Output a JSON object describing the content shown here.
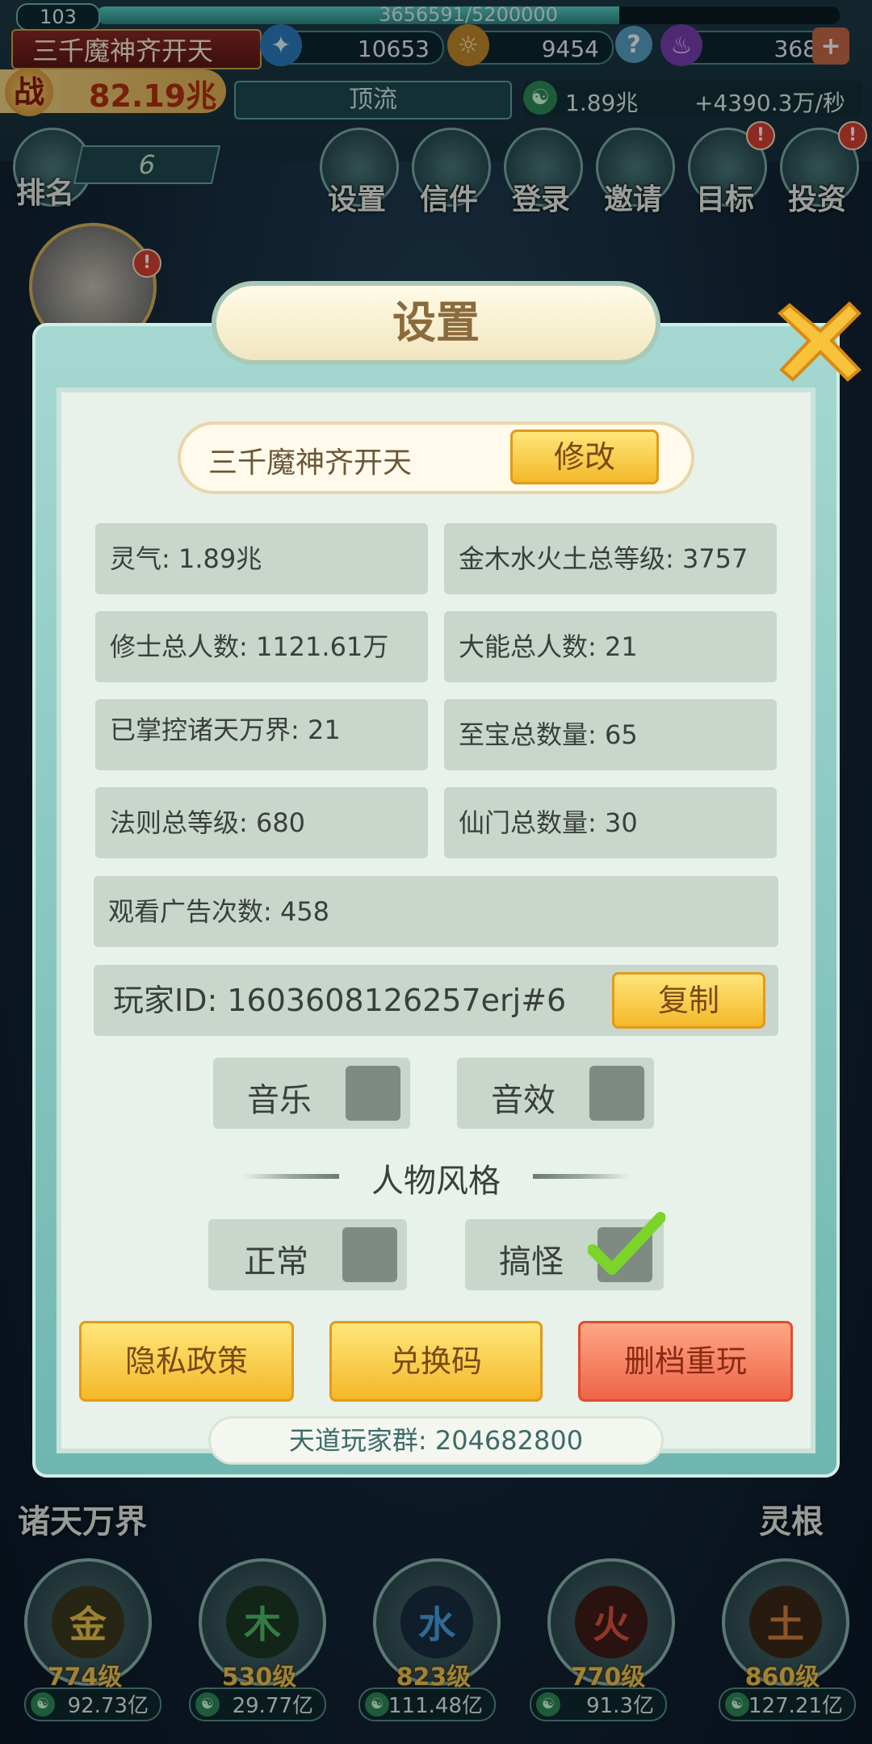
{
  "hud": {
    "level": "103",
    "xp_text": "3656591/5200000",
    "xp_progress": 0.703,
    "player_name": "三千魔神齐开天",
    "res1_value": "10653",
    "res2_value": "9454",
    "res3_value": "368",
    "power_label": "战",
    "power_value": "82.19兆",
    "rank_title": "顶流",
    "lingqi_value": "1.89兆",
    "lingqi_rate": "+4390.3万/秒"
  },
  "menu": {
    "rank_label": "排名",
    "rank_value": "6",
    "items": [
      {
        "label": "设置",
        "alert": false
      },
      {
        "label": "信件",
        "alert": false
      },
      {
        "label": "登录",
        "alert": false
      },
      {
        "label": "邀请",
        "alert": false
      },
      {
        "label": "目标",
        "alert": true
      },
      {
        "label": "投资",
        "alert": true
      }
    ],
    "alert_mark": "!"
  },
  "side": {
    "left_label": "诸天万界",
    "right_label": "灵根"
  },
  "elements": [
    {
      "glyph": "金",
      "level": "774级",
      "cost": "92.73亿",
      "color": "#f0c74a"
    },
    {
      "glyph": "木",
      "level": "530级",
      "cost": "29.77亿",
      "color": "#4fbf6a"
    },
    {
      "glyph": "水",
      "level": "823级",
      "cost": "111.48亿",
      "color": "#4aa3e0"
    },
    {
      "glyph": "火",
      "level": "770级",
      "cost": "91.3亿",
      "color": "#e2533c"
    },
    {
      "glyph": "土",
      "level": "860级",
      "cost": "127.21亿",
      "color": "#d9823a"
    }
  ],
  "dialog": {
    "title": "设置",
    "player_name": "三千魔神齐开天",
    "modify_label": "修改",
    "stats": [
      "灵气: 1.89兆",
      "金木水火土总等级: 3757",
      "修士总人数: 1121.61万",
      "大能总人数: 21",
      "已掌控诸天万界: 21",
      "至宝总数量: 65",
      "法则总等级: 680",
      "仙门总数量: 30"
    ],
    "ad_count": "观看广告次数: 458",
    "player_id": "玩家ID: 1603608126257erj#6",
    "copy_label": "复制",
    "music_label": "音乐",
    "sfx_label": "音效",
    "style_title": "人物风格",
    "style_normal": "正常",
    "style_funny": "搞怪",
    "privacy_label": "隐私政策",
    "redeem_label": "兑换码",
    "reset_label": "删档重玩",
    "group_text": "天道玩家群: 204682800"
  },
  "colors": {
    "accent_gold": "#f3b82a",
    "danger": "#ee6448",
    "check_green": "#7cd32a"
  }
}
